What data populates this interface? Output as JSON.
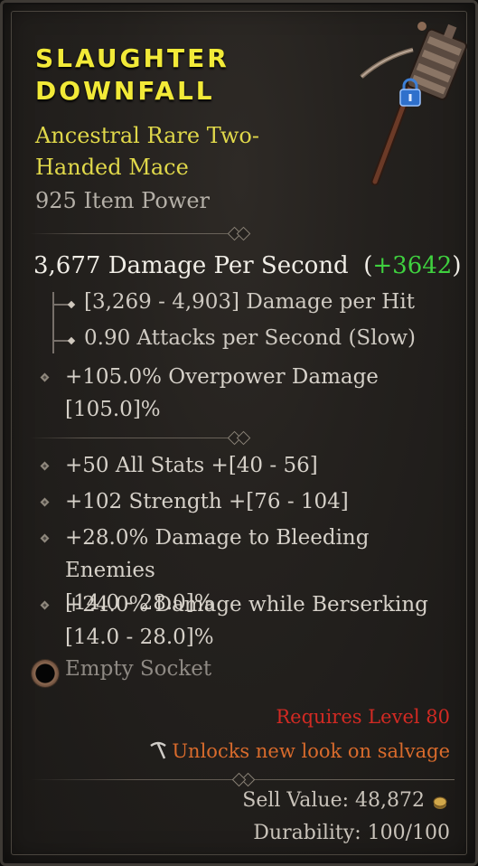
{
  "item": {
    "name_line1": "SLAUGHTER",
    "name_line2": "DOWNFALL",
    "type_line": "Ancestral Rare Two-Handed Mace",
    "item_power": "925 Item Power",
    "dps_value": "3,677 Damage Per Second",
    "dps_compare_open": "(",
    "dps_compare": "+3642",
    "dps_compare_close": ")",
    "damage_per_hit": "[3,269 - 4,903] Damage per Hit",
    "attack_speed": "0.90 Attacks per Second (Slow)",
    "implicit_line1": "+105.0% Overpower Damage",
    "implicit_line2": "[105.0]%",
    "affixes": [
      {
        "line1": "+50 All Stats +[40 - 56]"
      },
      {
        "line1": "+102 Strength +[76 - 104]"
      },
      {
        "line1": "+28.0% Damage to Bleeding Enemies",
        "line2": "[14.0 - 28.0]%"
      },
      {
        "line1": "+24.0% Damage while Berserking",
        "line2": "[14.0 - 28.0]%"
      }
    ],
    "socket": "Empty Socket",
    "requires": "Requires Level 80",
    "unlock_text": "Unlocks new look on salvage",
    "sell_value": "Sell Value: 48,872",
    "durability": "Durability: 100/100"
  },
  "icons": {
    "item_image": "mace-icon",
    "lock": "lock-icon",
    "socket": "socket-icon",
    "salvage": "pickaxe-icon",
    "gold": "gold-coin-icon"
  },
  "colors": {
    "rare_title": "#f2ea38",
    "type_text": "#e0d84a",
    "dps_gain": "#3fd13f",
    "requirement": "#d22a23",
    "unlock": "#d96b2c"
  }
}
